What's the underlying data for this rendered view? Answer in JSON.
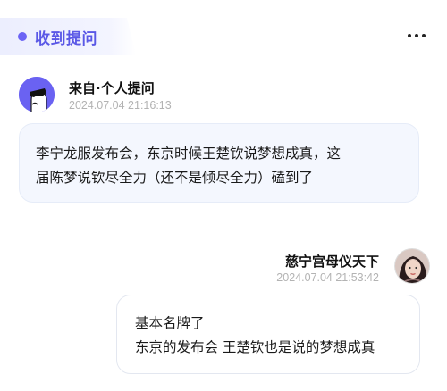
{
  "header": {
    "title": "收到提问"
  },
  "question": {
    "sender": "来自·个人提问",
    "timestamp": "2024.07.04 21:16:13",
    "text_lines": [
      "李宁龙服发布会，东京时候王楚钦说梦想成真，这",
      "届陈梦说钦尽全力（还不是倾尽全力）磕到了"
    ]
  },
  "reply": {
    "sender": "慈宁宫母仪天下",
    "timestamp": "2024.07.04 21:53:42",
    "text_lines": [
      "基本名牌了",
      "东京的发布会 王楚钦也是说的梦想成真"
    ]
  },
  "colors": {
    "accent": "#6b63f5",
    "bubble_question_bg": "#f4f7fe",
    "timestamp": "#b3b3b3"
  },
  "icons": {
    "more": "more-dots-icon",
    "anonymous_avatar": "sunglasses-face-avatar"
  }
}
